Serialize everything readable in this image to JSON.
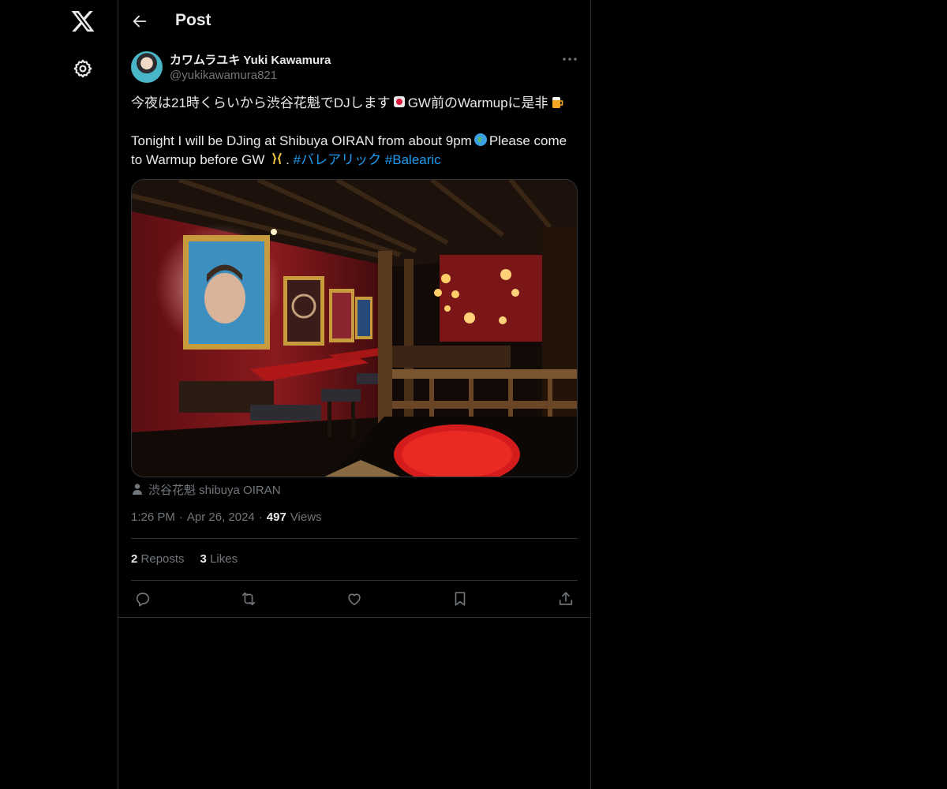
{
  "header": {
    "title": "Post"
  },
  "post": {
    "author_name": "カワムラユキ Yuki Kawamura",
    "author_handle": "@yukikawamura821",
    "text_jp_a": "今夜は21時くらいから渋谷花魁でDJします",
    "text_jp_b": "GW前のWarmupに是非",
    "text_en_a": "Tonight I will be DJing at Shibuya OIRAN from about 9pm",
    "text_en_b": "Please come to Warmup before GW",
    "text_en_c": ". ",
    "hashtag_1": "#バレアリック",
    "hashtag_2": "#Balearic",
    "location": "渋谷花魁 shibuya OIRAN",
    "time": "1:26 PM",
    "separator": "·",
    "date": "Apr 26, 2024",
    "views_count": "497",
    "views_label": "Views",
    "reposts_count": "2",
    "reposts_label": "Reposts",
    "likes_count": "3",
    "likes_label": "Likes"
  },
  "icons": {
    "logo": "x-logo-icon",
    "settings": "gear-icon",
    "back": "arrow-left-icon",
    "more": "more-horizontal-icon",
    "location": "person-icon",
    "reply": "reply-icon",
    "repost": "repost-icon",
    "like": "heart-icon",
    "bookmark": "bookmark-icon",
    "share": "share-icon"
  },
  "colors": {
    "background": "#000000",
    "text": "#e7e9ea",
    "secondary": "#71767b",
    "accent": "#1d9bf0",
    "border": "#2f3336"
  }
}
